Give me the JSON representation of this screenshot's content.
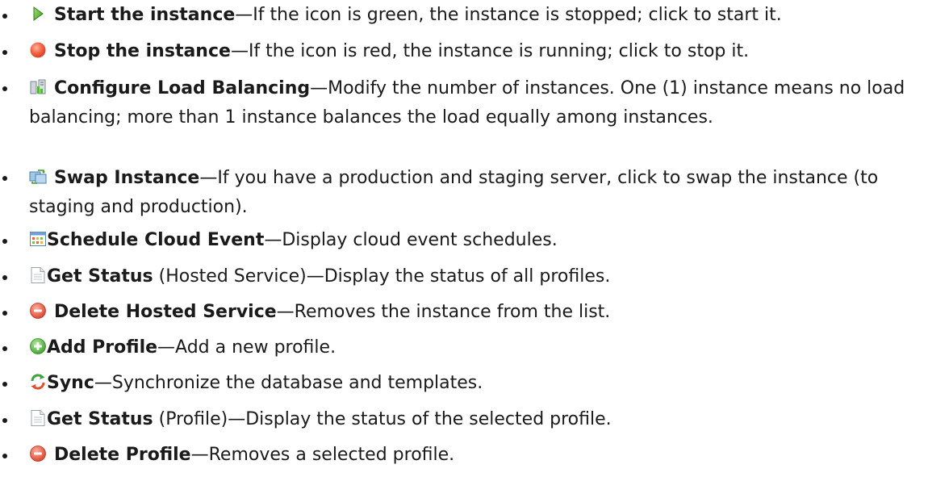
{
  "items": [
    {
      "icon": "play-triangle-green-icon",
      "name": "Start the instance",
      "qualifier": "",
      "description": "—If the icon is green, the instance is stopped; click to start it."
    },
    {
      "icon": "red-circle-icon",
      "name": "Stop the instance",
      "qualifier": "",
      "description": "—If the icon is red, the instance is running; click to stop it."
    },
    {
      "icon": "load-balancing-icon",
      "name": "Configure Load Balancing",
      "qualifier": "",
      "description": "—Modify the number of instances. One (1) instance means no load balancing; more than 1 instance balances the load equally among instances."
    },
    {
      "icon": "swap-instance-icon",
      "name": "Swap Instance",
      "qualifier": "",
      "description": "—If you have a production and staging server, click to swap the instance (to staging and production)."
    },
    {
      "icon": "calendar-icon",
      "name": "Schedule Cloud Event",
      "qualifier": "",
      "description": "—Display cloud event schedules."
    },
    {
      "icon": "document-icon",
      "name": "Get Status",
      "qualifier": " (Hosted Service)",
      "description": "—Display the status of all profiles."
    },
    {
      "icon": "delete-minus-icon",
      "name": "Delete Hosted Service",
      "qualifier": "",
      "description": "—Removes the instance from the list."
    },
    {
      "icon": "add-plus-icon",
      "name": "Add Profile",
      "qualifier": "",
      "description": "—Add a new profile."
    },
    {
      "icon": "sync-arrows-icon",
      "name": "Sync",
      "qualifier": "",
      "description": "—Synchronize the database and templates."
    },
    {
      "icon": "document-icon",
      "name": "Get Status",
      "qualifier": " (Profile)",
      "description": "—Display the status of the selected profile."
    },
    {
      "icon": "delete-minus-icon",
      "name": "Delete Profile",
      "qualifier": "",
      "description": "—Removes a selected profile."
    }
  ],
  "colors": {
    "text": "#1a1a1a",
    "start_green": "#4caf2a",
    "stop_red": "#f05a3c",
    "delete_red": "#e2493a",
    "add_green": "#49b83a",
    "sync_green": "#3aa53a",
    "sync_red": "#e0502e"
  }
}
